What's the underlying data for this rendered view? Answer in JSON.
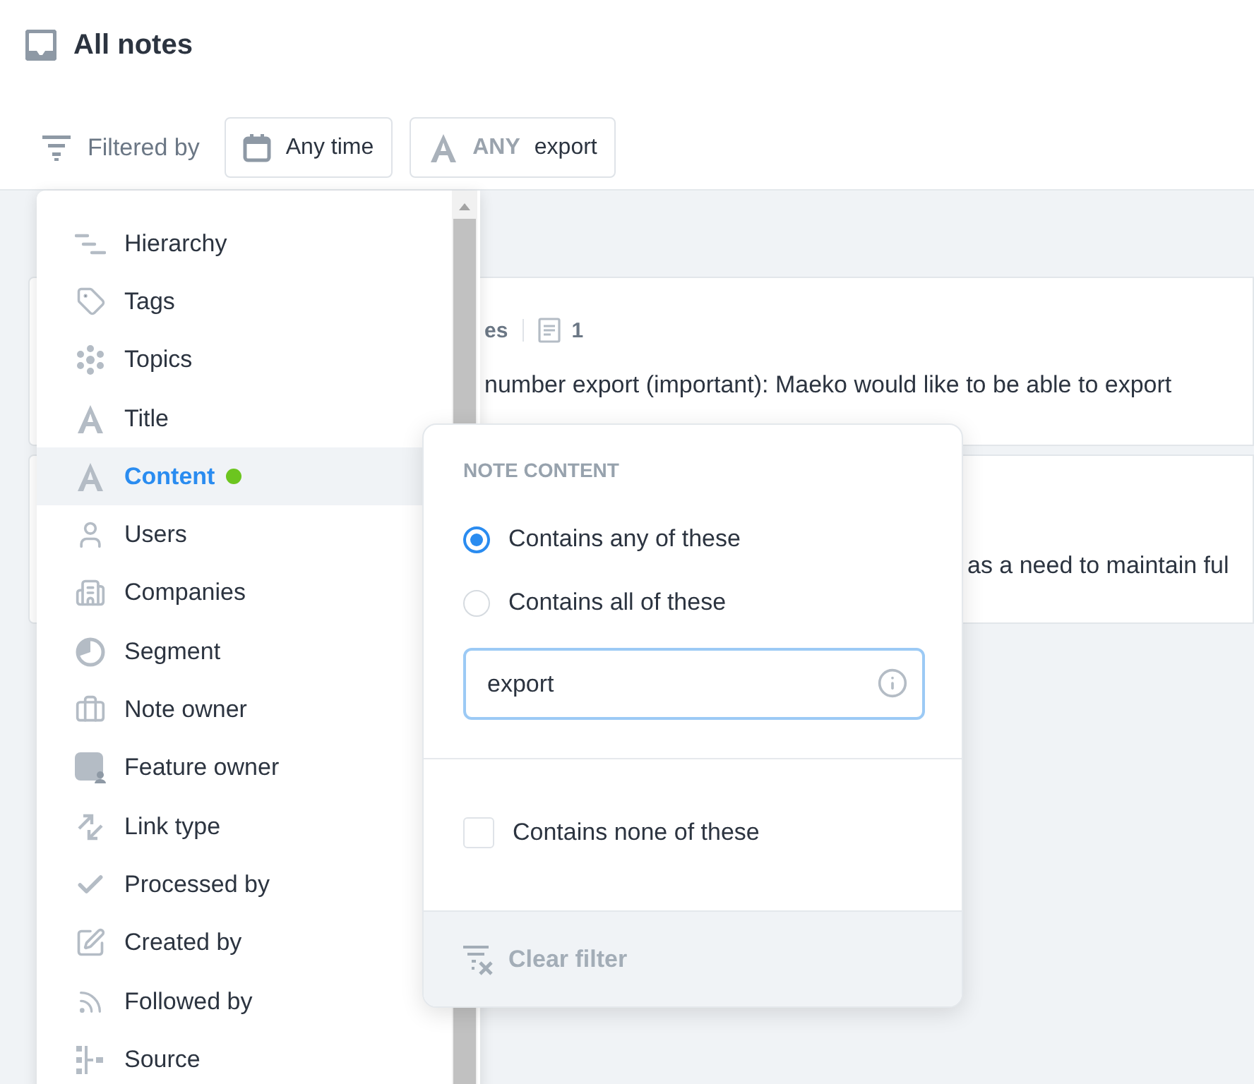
{
  "header": {
    "title": "All notes"
  },
  "filter_bar": {
    "label": "Filtered by",
    "chips": [
      {
        "kind": "date",
        "label": "Any time"
      },
      {
        "kind": "content",
        "mode": "ANY",
        "value": "export"
      }
    ]
  },
  "notes": [
    {
      "meta": "es",
      "count": "1",
      "text": "number export (important): Maeko would like to be able to export"
    },
    {
      "text": "as a need to maintain ful"
    }
  ],
  "filter_menu": {
    "items": [
      {
        "label": "Hierarchy",
        "selected": false,
        "active": false
      },
      {
        "label": "Tags",
        "selected": false,
        "active": false
      },
      {
        "label": "Topics",
        "selected": false,
        "active": false
      },
      {
        "label": "Title",
        "selected": false,
        "active": false
      },
      {
        "label": "Content",
        "selected": true,
        "active": true
      },
      {
        "label": "Users",
        "selected": false,
        "active": false
      },
      {
        "label": "Companies",
        "selected": false,
        "active": false
      },
      {
        "label": "Segment",
        "selected": false,
        "active": false
      },
      {
        "label": "Note owner",
        "selected": false,
        "active": false
      },
      {
        "label": "Feature owner",
        "selected": false,
        "active": false
      },
      {
        "label": "Link type",
        "selected": false,
        "active": false
      },
      {
        "label": "Processed by",
        "selected": false,
        "active": false
      },
      {
        "label": "Created by",
        "selected": false,
        "active": false
      },
      {
        "label": "Followed by",
        "selected": false,
        "active": false
      },
      {
        "label": "Source",
        "selected": false,
        "active": false
      }
    ]
  },
  "content_filter": {
    "heading": "NOTE CONTENT",
    "options": [
      {
        "label": "Contains any of these",
        "selected": true
      },
      {
        "label": "Contains all of these",
        "selected": false
      }
    ],
    "input": {
      "value": "export"
    },
    "exclude": {
      "label": "Contains none of these",
      "checked": false
    },
    "clear_button": {
      "label": "Clear filter"
    }
  }
}
